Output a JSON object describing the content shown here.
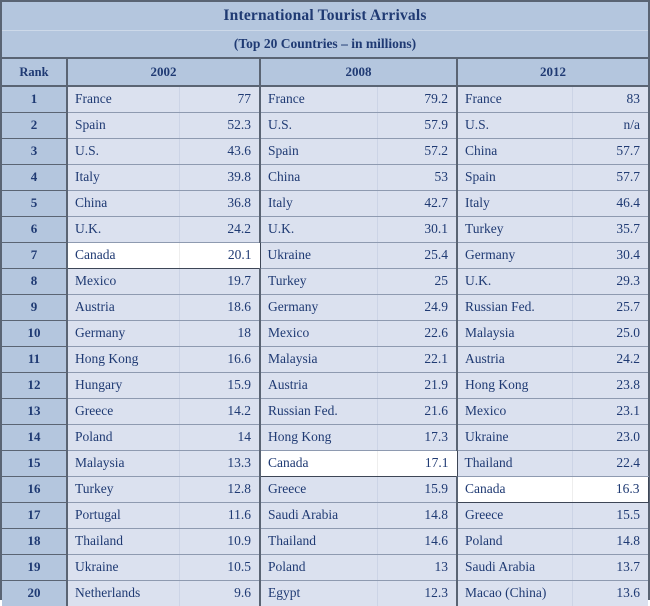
{
  "title": "International Tourist Arrivals",
  "subtitle": "(Top 20 Countries – in millions)",
  "colors": {
    "header_bg": "#b4c6de",
    "cell_bg": "#dbe1ef",
    "text": "#1f3a73",
    "border": "#5a6473",
    "highlight_bg": "#ffffff"
  },
  "headers": {
    "rank": "Rank",
    "year_2002": "2002",
    "year_2008": "2008",
    "year_2012": "2012"
  },
  "chart_data": {
    "type": "table",
    "title": "International Tourist Arrivals",
    "subtitle": "(Top 20 Countries – in millions)",
    "columns": [
      "Rank",
      "2002 Country",
      "2002 Arrivals",
      "2008 Country",
      "2008 Arrivals",
      "2012 Country",
      "2012 Arrivals"
    ],
    "highlight_country": "Canada",
    "rows": [
      {
        "rank": "1",
        "c2002": "France",
        "v2002": "77",
        "c2008": "France",
        "v2008": "79.2",
        "c2012": "France",
        "v2012": "83"
      },
      {
        "rank": "2",
        "c2002": "Spain",
        "v2002": "52.3",
        "c2008": "U.S.",
        "v2008": "57.9",
        "c2012": "U.S.",
        "v2012": "n/a"
      },
      {
        "rank": "3",
        "c2002": "U.S.",
        "v2002": "43.6",
        "c2008": "Spain",
        "v2008": "57.2",
        "c2012": "China",
        "v2012": "57.7"
      },
      {
        "rank": "4",
        "c2002": "Italy",
        "v2002": "39.8",
        "c2008": "China",
        "v2008": "53",
        "c2012": "Spain",
        "v2012": "57.7"
      },
      {
        "rank": "5",
        "c2002": "China",
        "v2002": "36.8",
        "c2008": "Italy",
        "v2008": "42.7",
        "c2012": "Italy",
        "v2012": "46.4"
      },
      {
        "rank": "6",
        "c2002": "U.K.",
        "v2002": "24.2",
        "c2008": "U.K.",
        "v2008": "30.1",
        "c2012": "Turkey",
        "v2012": "35.7"
      },
      {
        "rank": "7",
        "c2002": "Canada",
        "v2002": "20.1",
        "c2008": "Ukraine",
        "v2008": "25.4",
        "c2012": "Germany",
        "v2012": "30.4"
      },
      {
        "rank": "8",
        "c2002": "Mexico",
        "v2002": "19.7",
        "c2008": "Turkey",
        "v2008": "25",
        "c2012": "U.K.",
        "v2012": "29.3"
      },
      {
        "rank": "9",
        "c2002": "Austria",
        "v2002": "18.6",
        "c2008": "Germany",
        "v2008": "24.9",
        "c2012": "Russian Fed.",
        "v2012": "25.7"
      },
      {
        "rank": "10",
        "c2002": "Germany",
        "v2002": "18",
        "c2008": "Mexico",
        "v2008": "22.6",
        "c2012": "Malaysia",
        "v2012": "25.0"
      },
      {
        "rank": "11",
        "c2002": "Hong Kong",
        "v2002": "16.6",
        "c2008": "Malaysia",
        "v2008": "22.1",
        "c2012": "Austria",
        "v2012": "24.2"
      },
      {
        "rank": "12",
        "c2002": "Hungary",
        "v2002": "15.9",
        "c2008": "Austria",
        "v2008": "21.9",
        "c2012": "Hong Kong",
        "v2012": "23.8"
      },
      {
        "rank": "13",
        "c2002": "Greece",
        "v2002": "14.2",
        "c2008": "Russian Fed.",
        "v2008": "21.6",
        "c2012": "Mexico",
        "v2012": "23.1"
      },
      {
        "rank": "14",
        "c2002": "Poland",
        "v2002": "14",
        "c2008": "Hong Kong",
        "v2008": "17.3",
        "c2012": "Ukraine",
        "v2012": "23.0"
      },
      {
        "rank": "15",
        "c2002": "Malaysia",
        "v2002": "13.3",
        "c2008": "Canada",
        "v2008": "17.1",
        "c2012": "Thailand",
        "v2012": "22.4"
      },
      {
        "rank": "16",
        "c2002": "Turkey",
        "v2002": "12.8",
        "c2008": "Greece",
        "v2008": "15.9",
        "c2012": "Canada",
        "v2012": "16.3"
      },
      {
        "rank": "17",
        "c2002": "Portugal",
        "v2002": "11.6",
        "c2008": "Saudi Arabia",
        "v2008": "14.8",
        "c2012": "Greece",
        "v2012": "15.5"
      },
      {
        "rank": "18",
        "c2002": "Thailand",
        "v2002": "10.9",
        "c2008": "Thailand",
        "v2008": "14.6",
        "c2012": "Poland",
        "v2012": "14.8"
      },
      {
        "rank": "19",
        "c2002": "Ukraine",
        "v2002": "10.5",
        "c2008": "Poland",
        "v2008": "13",
        "c2012": "Saudi Arabia",
        "v2012": "13.7"
      },
      {
        "rank": "20",
        "c2002": "Netherlands",
        "v2002": "9.6",
        "c2008": "Egypt",
        "v2008": "12.3",
        "c2012": "Macao (China)",
        "v2012": "13.6"
      }
    ]
  }
}
